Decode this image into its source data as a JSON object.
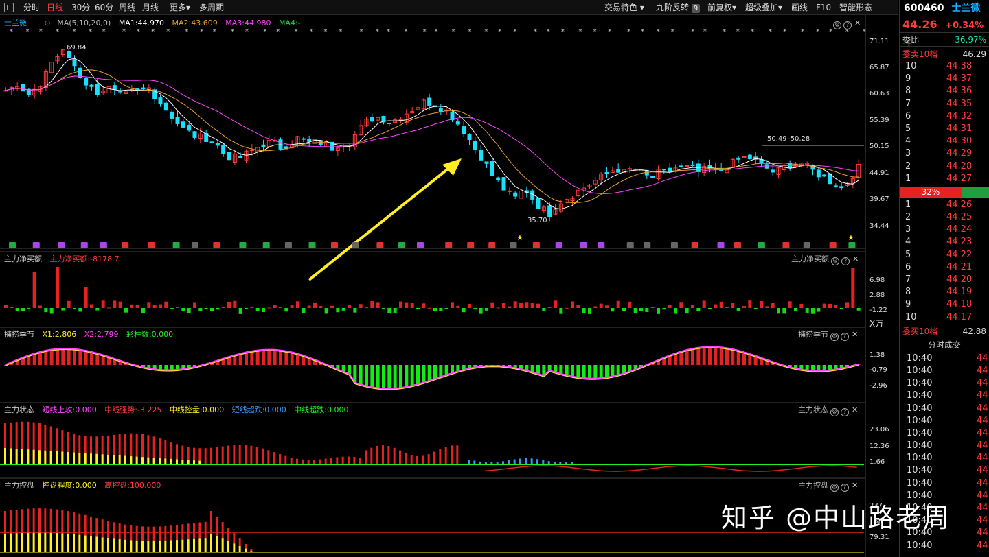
{
  "toolbar": {
    "items": [
      "分时",
      "日线",
      "30分",
      "60分",
      "周线",
      "月线",
      "更多",
      "多周期"
    ],
    "more_arrow": "▾",
    "right_items": [
      "交易特色 ▾",
      "九阶反转",
      "前复权▾",
      "超级叠加▾",
      "画线",
      "F10",
      "智能形态"
    ],
    "nine_badge": "9"
  },
  "stock": {
    "code": "600460",
    "name": "士兰微",
    "price": "44.26",
    "change": "+0.34%",
    "change_extra": "+"
  },
  "main_panel": {
    "name": "士兰微",
    "ma_params": "MA(5,10,20,0)",
    "ma1": "MA1:44.970",
    "ma2": "MA2:43.609",
    "ma3": "MA3:44.980",
    "ma4": "MA4:-",
    "axis": [
      "71.11",
      "65.87",
      "60.63",
      "55.39",
      "50.15",
      "44.91",
      "39.67",
      "34.44"
    ],
    "high_label": "69.84",
    "low_label": "35.70",
    "range_label": "50.49–50.28"
  },
  "panel_capital": {
    "title": "主力净买额",
    "value": "主力净买额:-8178.7",
    "axis": [
      "6.98",
      "2.88",
      "-1.22"
    ],
    "unit": "X万"
  },
  "panel_season": {
    "title": "捕捞季节",
    "x1": "X1:2.806",
    "x2": "X2:2.799",
    "bars": "彩柱数:0.000",
    "axis": [
      "1.38",
      "-0.79",
      "-2.96"
    ]
  },
  "panel_state": {
    "title": "主力状态",
    "items": [
      "短线上攻:0.000",
      "中线强势:-3.225",
      "中线控盘:0.000",
      "短线超跌:0.000",
      "中线超跌:0.000"
    ],
    "axis": [
      "23.06",
      "12.36",
      "1.66"
    ]
  },
  "panel_control": {
    "title": "主力控盘",
    "degree": "控盘程度:0.000",
    "high": "高控盘:100.000",
    "axis": [
      "237",
      "158",
      "79.31"
    ]
  },
  "sidebar": {
    "weibi_label": "委比",
    "weibi_value": "-36.97%",
    "sell_label": "委卖10档",
    "sell_total": "46.29",
    "buy_label": "委买10档",
    "buy_total": "42.88",
    "sell_rows": [
      {
        "level": "10",
        "price": "44.38"
      },
      {
        "level": "9",
        "price": "44.37"
      },
      {
        "level": "8",
        "price": "44.36"
      },
      {
        "level": "7",
        "price": "44.35"
      },
      {
        "level": "6",
        "price": "44.32"
      },
      {
        "level": "5",
        "price": "44.31"
      },
      {
        "level": "4",
        "price": "44.30"
      },
      {
        "level": "3",
        "price": "44.29"
      },
      {
        "level": "2",
        "price": "44.28"
      },
      {
        "level": "1",
        "price": "44.27"
      }
    ],
    "ratio": "32%",
    "buy_rows": [
      {
        "level": "1",
        "price": "44.26"
      },
      {
        "level": "2",
        "price": "44.25"
      },
      {
        "level": "3",
        "price": "44.24"
      },
      {
        "level": "4",
        "price": "44.23"
      },
      {
        "level": "5",
        "price": "44.22"
      },
      {
        "level": "6",
        "price": "44.21"
      },
      {
        "level": "7",
        "price": "44.20"
      },
      {
        "level": "8",
        "price": "44.19"
      },
      {
        "level": "9",
        "price": "44.18"
      },
      {
        "level": "10",
        "price": "44.17"
      }
    ],
    "trades_title": "分时成交",
    "trades": [
      "10:40",
      "10:40",
      "10:40",
      "10:40",
      "10:40",
      "10:40",
      "10:40",
      "10:40",
      "10:40",
      "10:40",
      "10:40",
      "10:40",
      "10:40",
      "10:40",
      "10:40",
      "10:40"
    ],
    "trade_price": "44"
  },
  "watermark": "知乎 @中山路老周",
  "colors": {
    "up": "#ff3c3c",
    "down": "#19e0ff",
    "green": "#22ee22",
    "yellow": "#ffee22",
    "magenta": "#ff44ff"
  },
  "chart_data": {
    "type": "candlestick",
    "price_range": [
      34.44,
      71.11
    ],
    "close_series": [
      62,
      63,
      61,
      60,
      62,
      66,
      68,
      69,
      67,
      64,
      62,
      61,
      62,
      61,
      60,
      61,
      61,
      62,
      60,
      58,
      56,
      54,
      53,
      52,
      52,
      51,
      49,
      48,
      48,
      49,
      50,
      51,
      51,
      50,
      51,
      52,
      51,
      51,
      51,
      50,
      51,
      51,
      53,
      55,
      56,
      56,
      55,
      56,
      57,
      58,
      59,
      59,
      58,
      57,
      55,
      53,
      50,
      48,
      45,
      43,
      41,
      40,
      42,
      40,
      38,
      37,
      39,
      40,
      41,
      42,
      43,
      44,
      45,
      46,
      45,
      46,
      45,
      44,
      45,
      45,
      46,
      46,
      46,
      45,
      46,
      45,
      46,
      47,
      48,
      48,
      47,
      46,
      45,
      46,
      47,
      47,
      46,
      45,
      44,
      43,
      42,
      44,
      46
    ]
  }
}
